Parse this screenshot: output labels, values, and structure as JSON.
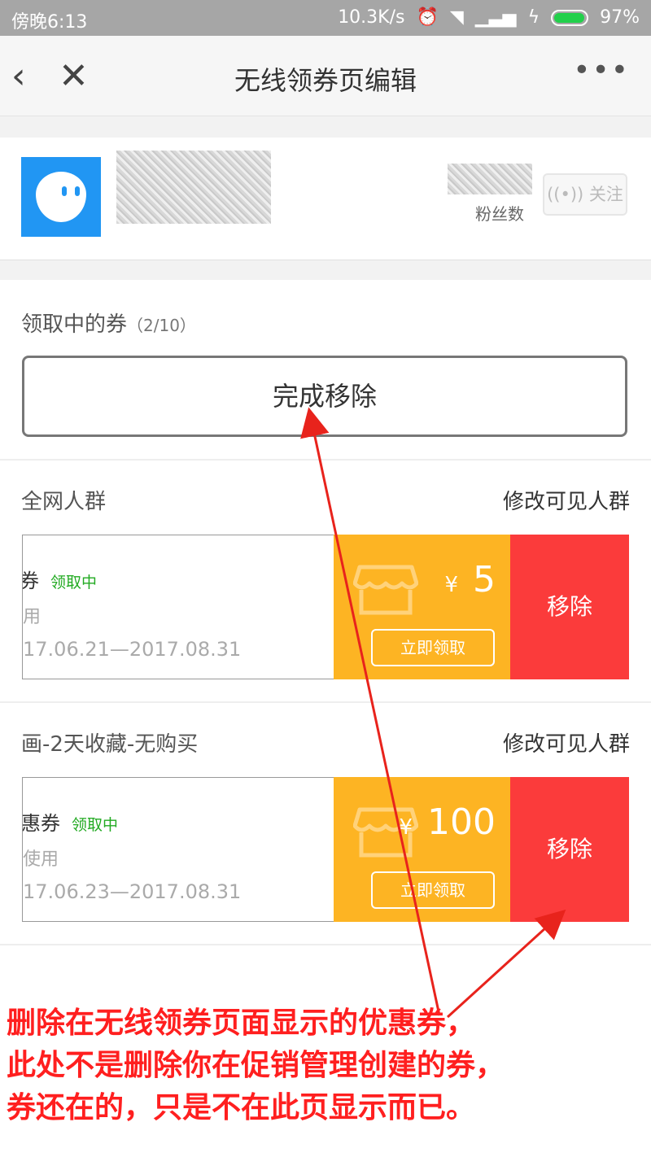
{
  "status_bar": {
    "time": "傍晚6:13",
    "net_speed": "10.3K/s",
    "battery": "97%"
  },
  "nav": {
    "back_icon": "‹",
    "close_icon": "✕",
    "title": "无线领券页编辑",
    "more_icon": "•••"
  },
  "shop": {
    "fans_label": "粉丝数",
    "follow_label": "关注"
  },
  "coupons_section": {
    "title": "领取中的券",
    "count": "（2/10）",
    "done_button": "完成移除"
  },
  "groups": [
    {
      "title": "全网人群",
      "edit_label": "修改可见人群",
      "coupon": {
        "name": "券",
        "status": "领取中",
        "usage": "用",
        "date": "17.06.21—2017.08.31",
        "currency": "¥",
        "amount": "5",
        "get_button": "立即领取",
        "remove_button": "移除"
      }
    },
    {
      "title": "画-2天收藏-无购买",
      "edit_label": "修改可见人群",
      "coupon": {
        "name": "惠券",
        "status": "领取中",
        "usage": "使用",
        "date": "17.06.23—2017.08.31",
        "currency": "¥",
        "amount": "100",
        "get_button": "立即领取",
        "remove_button": "移除"
      }
    }
  ],
  "annotation": {
    "text": "删除在无线领券页面显示的优惠券，\n此处不是删除你在促销管理创建的券，\n券还在的，只是不在此页显示而已。",
    "color": "#ff1f1f"
  },
  "colors": {
    "coupon_yellow": "#fdb423",
    "remove_red": "#fb3b3b",
    "status_green": "#22aa22"
  }
}
